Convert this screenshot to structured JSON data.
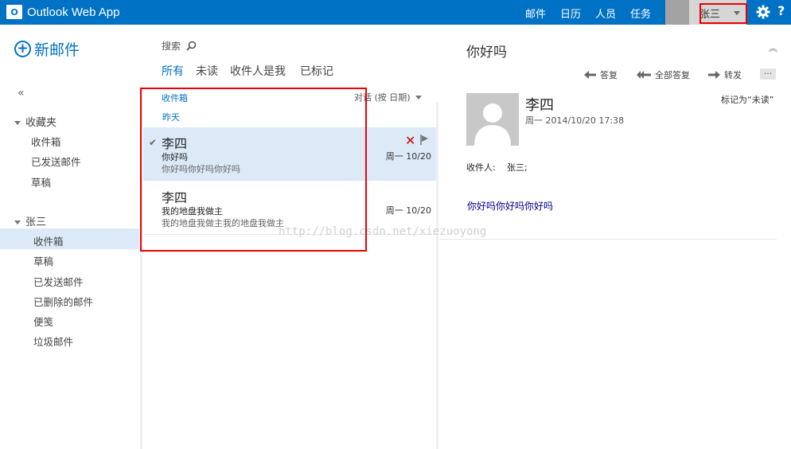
{
  "app": {
    "title": "Outlook Web App",
    "logo_letter": "O"
  },
  "nav": {
    "items": [
      {
        "label": "邮件",
        "active": true
      },
      {
        "label": "日历"
      },
      {
        "label": "人员"
      },
      {
        "label": "任务"
      }
    ],
    "user": "张三",
    "help": "?"
  },
  "sidebar": {
    "new_mail": "新邮件",
    "collapse": "«",
    "favorites": {
      "label": "收藏夹",
      "items": [
        "收件箱",
        "已发送邮件",
        "草稿"
      ]
    },
    "account": {
      "label": "张三",
      "items": [
        "收件箱",
        "草稿",
        "已发送邮件",
        "已删除的邮件",
        "便笺",
        "垃圾邮件"
      ],
      "selected_index": 0
    }
  },
  "list": {
    "search_label": "搜索",
    "filters": [
      "所有",
      "未读",
      "收件人是我",
      "已标记"
    ],
    "active_filter": 0,
    "folder": "收件箱",
    "sort": "对话 (按 日期)",
    "group": "昨天",
    "messages": [
      {
        "from": "李四",
        "subject": "你好吗",
        "preview": "你好吗你好吗你好吗",
        "date": "周一 10/20",
        "selected": true
      },
      {
        "from": "李四",
        "subject": "我的地盘我做主",
        "preview": "我的地盘我做主我的地盘我做主",
        "date": "周一 10/20",
        "selected": false
      }
    ]
  },
  "reading": {
    "subject": "你好吗",
    "expand": "«",
    "actions": [
      "答复",
      "全部答复",
      "转发"
    ],
    "more": "...",
    "sender": "李四",
    "sent": "周一 2014/10/20 17:38",
    "mark_unread": "标记为“未读”",
    "to_label": "收件人:",
    "to_value": "张三;",
    "body": "你好吗你好吗你好吗"
  },
  "watermark": "http://blog.csdn.net/xiezuoyong",
  "colors": {
    "brand": "#0072c6",
    "selected": "#dce9f7",
    "highlight": "#e00000",
    "delete": "#cc0000"
  }
}
